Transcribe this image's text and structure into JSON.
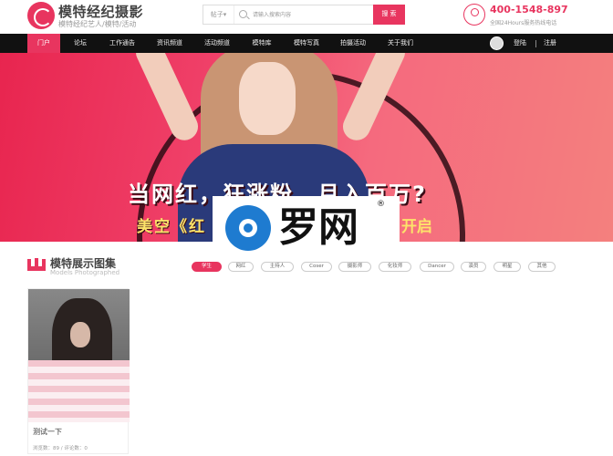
{
  "header": {
    "logo_title": "模特经纪摄影",
    "logo_sub": "模特经纪艺人/模特/活动",
    "search_type": "帖子▾",
    "search_placeholder": "请输入搜索内容",
    "search_button": "搜 索",
    "phone": "400-1548-897",
    "phone_note": "全国24Hours服务热线电话"
  },
  "nav": {
    "items": [
      "门户",
      "论坛",
      "工作通告",
      "资讯频道",
      "活动频道",
      "模特库",
      "模特写真",
      "拍摄活动",
      "关于我们"
    ],
    "login": "登陆",
    "register": "注册"
  },
  "banner": {
    "slogan": "当网红，狂涨粉，月入百万?",
    "slogan_sub": "美空《红",
    "slogan_sub_right": "开启"
  },
  "watermark": {
    "text": "罗网",
    "reg": "®"
  },
  "models": {
    "title": "模特展示图集",
    "subtitle": "Models Photographed",
    "filters": [
      "学生",
      "网红",
      "主持人",
      "Coser",
      "摄影师",
      "化妆师",
      "Dancer",
      "演员",
      "明星",
      "其他"
    ],
    "active_filter": "学生",
    "cards": [
      {
        "name": "测试一下",
        "meta": "浏览数：89 / 评论数：0"
      }
    ]
  },
  "colors": {
    "accent": "#e8355f",
    "nav_bg": "#111111"
  }
}
